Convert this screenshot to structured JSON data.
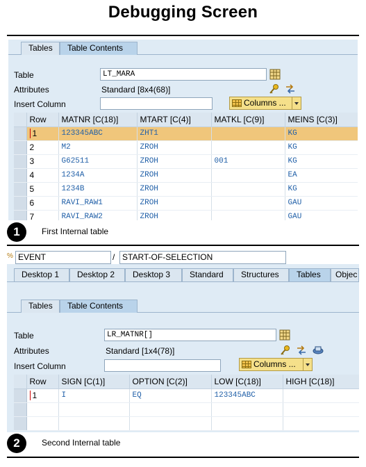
{
  "page": {
    "title": "Debugging Screen"
  },
  "first": {
    "tabs": [
      "Tables",
      "Table Contents"
    ],
    "table_label": "Table",
    "table_value": "LT_MARA",
    "attributes_label": "Attributes",
    "attributes_value": "Standard [8x4(68)]",
    "insert_column_label": "Insert Column",
    "insert_column_value": "",
    "columns_button": "Columns ...",
    "grid": {
      "headers": [
        "Row",
        "MATNR [C(18)]",
        "MTART [C(4)]",
        "MATKL [C(9)]",
        "MEINS [C(3)]"
      ],
      "rows": [
        [
          "1",
          "123345ABC",
          "ZHT1",
          "",
          "KG"
        ],
        [
          "2",
          "M2",
          "ZROH",
          "",
          "KG"
        ],
        [
          "3",
          "G62511",
          "ZROH",
          "001",
          "KG"
        ],
        [
          "4",
          "1234A",
          "ZROH",
          "",
          "EA"
        ],
        [
          "5",
          "1234B",
          "ZROH",
          "",
          "KG"
        ],
        [
          "6",
          "RAVI_RAW1",
          "ZROH",
          "",
          "GAU"
        ],
        [
          "7",
          "RAVI_RAW2",
          "ZROH",
          "",
          "GAU"
        ]
      ]
    },
    "caption_number": "1",
    "caption_text": "First Internal table"
  },
  "second": {
    "event_field": "EVENT",
    "separator": "/",
    "event_value": "START-OF-SELECTION",
    "desktop_tabs": [
      "Desktop 1",
      "Desktop 2",
      "Desktop 3",
      "Standard",
      "Structures",
      "Tables",
      "Objec"
    ],
    "tabs": [
      "Tables",
      "Table Contents"
    ],
    "table_label": "Table",
    "table_value": "LR_MATNR[]",
    "attributes_label": "Attributes",
    "attributes_value": "Standard [1x4(78)]",
    "insert_column_label": "Insert Column",
    "insert_column_value": "",
    "columns_button": "Columns ...",
    "grid": {
      "headers": [
        "Row",
        "SIGN [C(1)]",
        "OPTION [C(2)]",
        "LOW [C(18)]",
        "HIGH [C(18)]"
      ],
      "rows": [
        [
          "1",
          "I",
          "EQ",
          "123345ABC",
          ""
        ]
      ]
    },
    "caption_number": "2",
    "caption_text": "Second Internal table"
  },
  "colors": {
    "panel_bg": "#dfebf5",
    "highlight_row": "#f0c67b",
    "cell_text": "#2160a8",
    "button_bg": "#f5e08a"
  },
  "icons": [
    "table-icon",
    "key-icon",
    "transfer-icon",
    "save-icon",
    "grid-icon",
    "chevron-down-icon"
  ]
}
